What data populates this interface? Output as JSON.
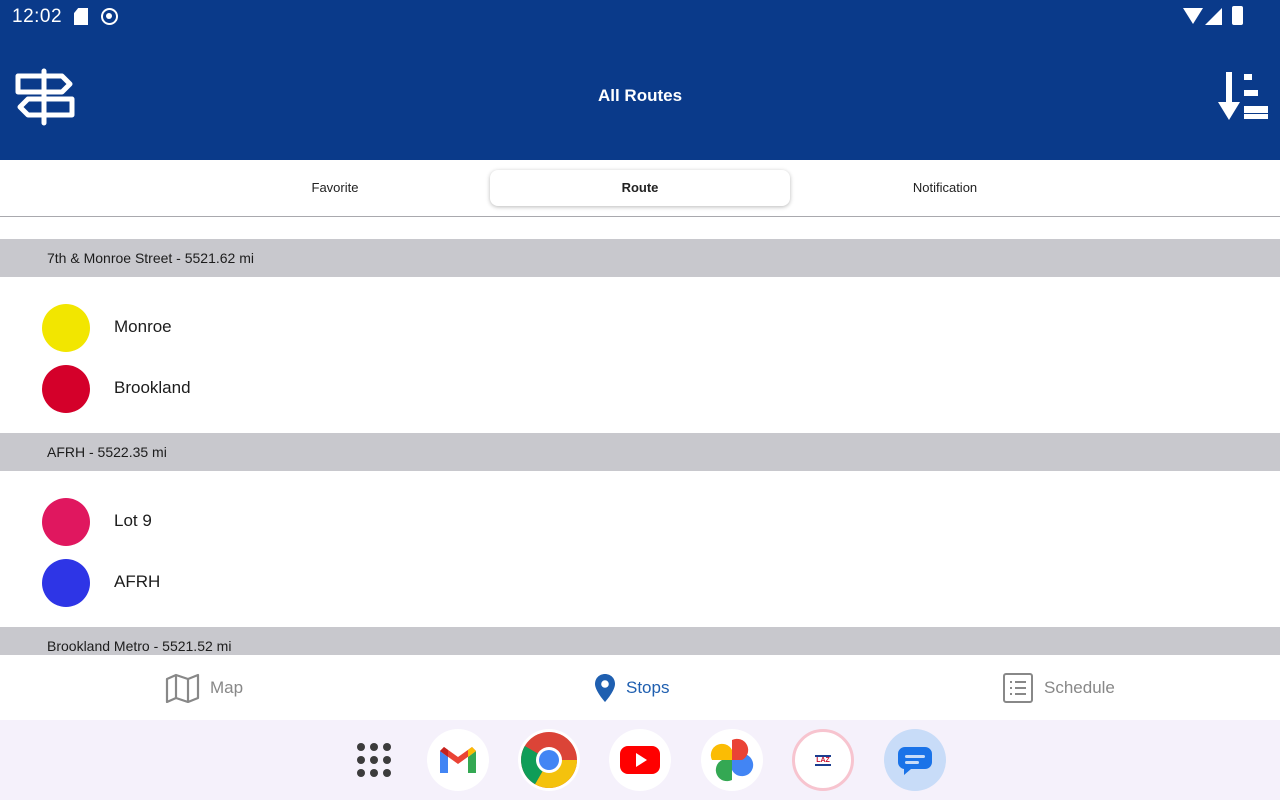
{
  "status_bar": {
    "time": "12:02",
    "icons": [
      "sd-card-icon",
      "face-icon",
      "wifi-icon",
      "signal-icon",
      "battery-icon"
    ]
  },
  "app_bar": {
    "title": "All Routes",
    "left_icon": "signpost-icon",
    "right_icon": "sort-icon",
    "background": "#0a3a8a"
  },
  "tabs": [
    {
      "label": "Favorite",
      "active": false
    },
    {
      "label": "Route",
      "active": true
    },
    {
      "label": "Notification",
      "active": false
    }
  ],
  "stops": [
    {
      "header": "7th & Monroe Street - 5521.62 mi",
      "routes": [
        {
          "name": "Monroe",
          "color": "#f2e600"
        },
        {
          "name": "Brookland",
          "color": "#d4002a"
        }
      ]
    },
    {
      "header": "AFRH - 5522.35 mi",
      "routes": [
        {
          "name": "Lot 9",
          "color": "#e0175f"
        },
        {
          "name": "AFRH",
          "color": "#2e35e6"
        }
      ]
    },
    {
      "header": "Brookland Metro - 5521.52 mi",
      "routes": []
    }
  ],
  "bottom_nav": [
    {
      "label": "Map",
      "icon": "map-icon",
      "active": false
    },
    {
      "label": "Stops",
      "icon": "location-pin-icon",
      "active": true
    },
    {
      "label": "Schedule",
      "icon": "schedule-list-icon",
      "active": false
    }
  ],
  "dock": {
    "apps": [
      "app-drawer-icon",
      "gmail-icon",
      "chrome-icon",
      "youtube-icon",
      "photos-icon",
      "laz-parking-icon",
      "messages-icon"
    ],
    "laz_label": "LAZ"
  },
  "colors": {
    "accent": "#1f5fb0",
    "section_header_bg": "#c8c8cd"
  }
}
